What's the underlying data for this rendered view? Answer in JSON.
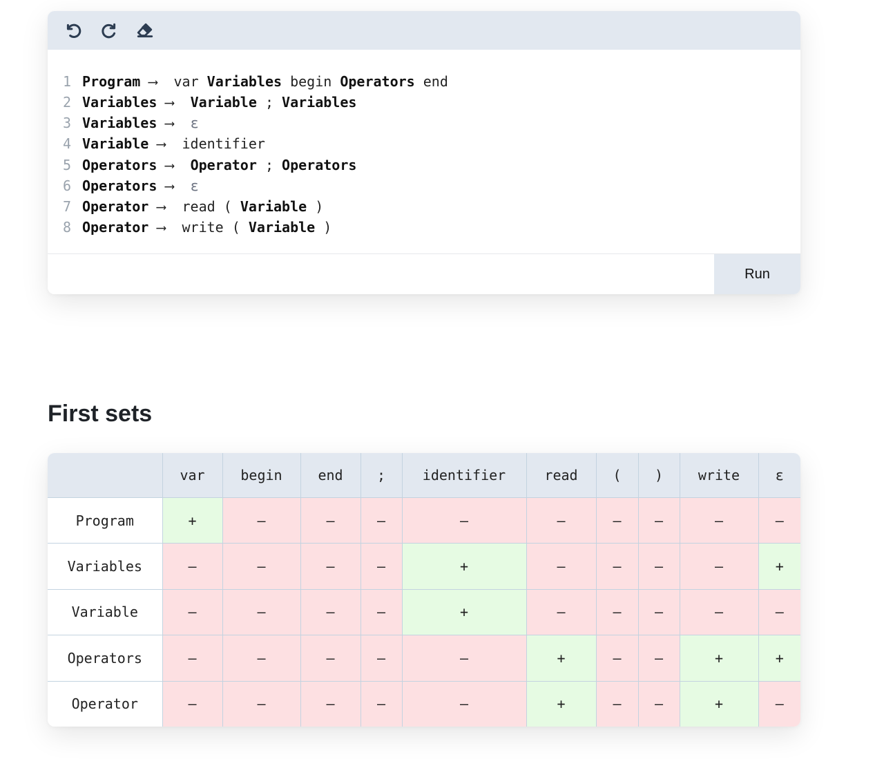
{
  "toolbar": {
    "undo_icon": "undo-icon",
    "redo_icon": "redo-icon",
    "clear_icon": "eraser-icon"
  },
  "editor": {
    "arrow": "⟶",
    "lines": [
      {
        "num": "1",
        "lhs": "Program",
        "rhs": [
          {
            "t": "var",
            "nt": false
          },
          {
            "t": "Variables",
            "nt": true
          },
          {
            "t": "begin",
            "nt": false
          },
          {
            "t": "Operators",
            "nt": true
          },
          {
            "t": "end",
            "nt": false
          }
        ]
      },
      {
        "num": "2",
        "lhs": "Variables",
        "rhs": [
          {
            "t": "Variable",
            "nt": true
          },
          {
            "t": ";",
            "nt": false
          },
          {
            "t": "Variables",
            "nt": true
          }
        ]
      },
      {
        "num": "3",
        "lhs": "Variables",
        "rhs": [
          {
            "t": "ε",
            "nt": false,
            "eps": true
          }
        ]
      },
      {
        "num": "4",
        "lhs": "Variable",
        "rhs": [
          {
            "t": "identifier",
            "nt": false
          }
        ]
      },
      {
        "num": "5",
        "lhs": "Operators",
        "rhs": [
          {
            "t": "Operator",
            "nt": true
          },
          {
            "t": ";",
            "nt": false
          },
          {
            "t": "Operators",
            "nt": true
          }
        ]
      },
      {
        "num": "6",
        "lhs": "Operators",
        "rhs": [
          {
            "t": "ε",
            "nt": false,
            "eps": true
          }
        ]
      },
      {
        "num": "7",
        "lhs": "Operator",
        "rhs": [
          {
            "t": "read",
            "nt": false
          },
          {
            "t": "(",
            "nt": false
          },
          {
            "t": "Variable",
            "nt": true
          },
          {
            "t": ")",
            "nt": false
          }
        ]
      },
      {
        "num": "8",
        "lhs": "Operator",
        "rhs": [
          {
            "t": "write",
            "nt": false
          },
          {
            "t": "(",
            "nt": false
          },
          {
            "t": "Variable",
            "nt": true
          },
          {
            "t": ")",
            "nt": false
          }
        ]
      }
    ]
  },
  "input": {
    "value": "",
    "placeholder": ""
  },
  "run_label": "Run",
  "first_sets": {
    "title": "First sets",
    "columns": [
      "var",
      "begin",
      "end",
      ";",
      "identifier",
      "read",
      "(",
      ")",
      "write",
      "ε"
    ],
    "rows": [
      {
        "name": "Program",
        "cells": [
          "+",
          "–",
          "–",
          "–",
          "–",
          "–",
          "–",
          "–",
          "–",
          "–"
        ]
      },
      {
        "name": "Variables",
        "cells": [
          "–",
          "–",
          "–",
          "–",
          "+",
          "–",
          "–",
          "–",
          "–",
          "+"
        ]
      },
      {
        "name": "Variable",
        "cells": [
          "–",
          "–",
          "–",
          "–",
          "+",
          "–",
          "–",
          "–",
          "–",
          "–"
        ]
      },
      {
        "name": "Operators",
        "cells": [
          "–",
          "–",
          "–",
          "–",
          "–",
          "+",
          "–",
          "–",
          "+",
          "+"
        ]
      },
      {
        "name": "Operator",
        "cells": [
          "–",
          "–",
          "–",
          "–",
          "–",
          "+",
          "–",
          "–",
          "+",
          "–"
        ]
      }
    ],
    "colors": {
      "plus": "#e6fbe3",
      "minus": "#fde0e2",
      "header": "#e2e8f0"
    }
  }
}
